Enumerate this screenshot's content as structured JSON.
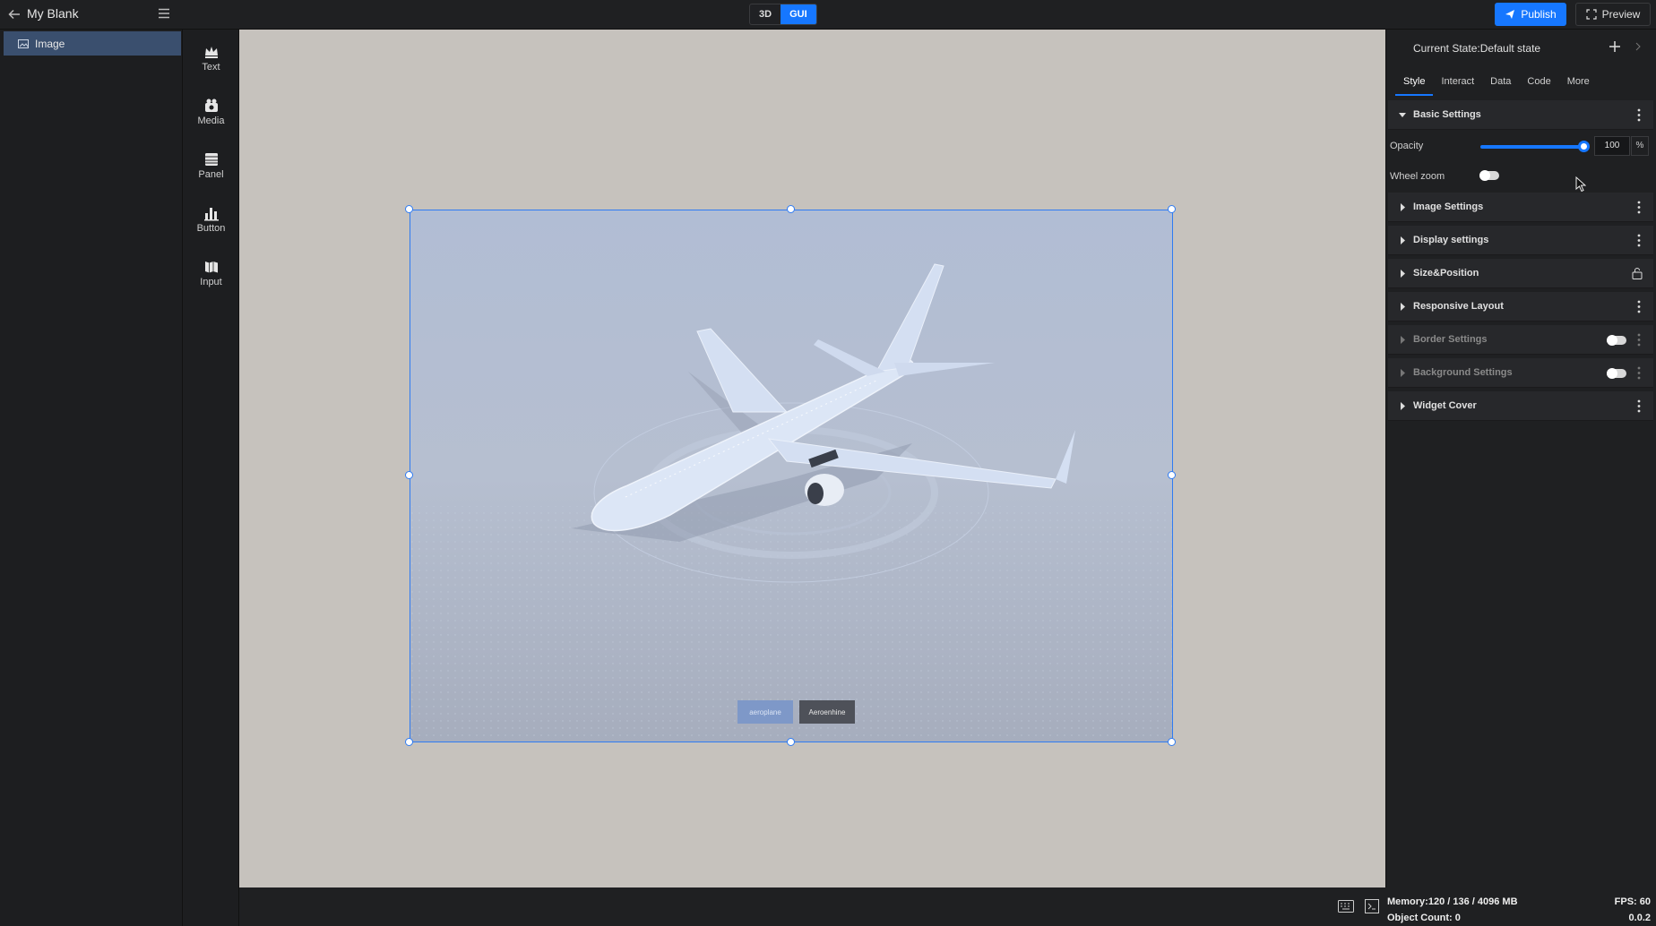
{
  "topbar": {
    "title": "My Blank",
    "modes": [
      {
        "label": "3D",
        "active": false
      },
      {
        "label": "GUI",
        "active": true
      }
    ],
    "publish_label": "Publish",
    "preview_label": "Preview"
  },
  "layers": [
    {
      "label": "Image",
      "selected": true,
      "icon": "image-icon"
    }
  ],
  "widgets": [
    {
      "label": "Text",
      "icon": "crown-icon"
    },
    {
      "label": "Media",
      "icon": "media-icon"
    },
    {
      "label": "Panel",
      "icon": "panel-icon"
    },
    {
      "label": "Button",
      "icon": "bar-chart-icon"
    },
    {
      "label": "Input",
      "icon": "map-icon"
    }
  ],
  "canvas": {
    "image_buttons": [
      "aeroplane",
      "Aeroenhine"
    ]
  },
  "props": {
    "state_title": "Current State:Default state",
    "tabs": [
      {
        "label": "Style",
        "active": true
      },
      {
        "label": "Interact",
        "active": false
      },
      {
        "label": "Data",
        "active": false
      },
      {
        "label": "Code",
        "active": false
      },
      {
        "label": "More",
        "active": false
      }
    ],
    "basic_settings": "Basic Settings",
    "opacity_label": "Opacity",
    "opacity_value": "100",
    "opacity_unit": "%",
    "opacity_level": 1.0,
    "wheel_zoom_label": "Wheel zoom",
    "wheel_zoom_on": false,
    "sections": [
      {
        "label": "Image Settings",
        "dim": false,
        "control": "kebab"
      },
      {
        "label": "Display settings",
        "dim": false,
        "control": "kebab"
      },
      {
        "label": "Size&Position",
        "dim": false,
        "control": "lock"
      },
      {
        "label": "Responsive Layout",
        "dim": false,
        "control": "kebab"
      },
      {
        "label": "Border Settings",
        "dim": true,
        "control": "toggle"
      },
      {
        "label": "Background Settings",
        "dim": true,
        "control": "toggle"
      },
      {
        "label": "Widget Cover",
        "dim": false,
        "control": "kebab"
      }
    ]
  },
  "status": {
    "memory": "Memory:120 / 136 / 4096 MB",
    "fps": "FPS: 60",
    "object_count": "Object Count: 0",
    "version": "0.0.2"
  },
  "colors": {
    "accent": "#1677ff",
    "selection": "#2f7bf2",
    "canvas_bg": "#c6c2bd"
  }
}
